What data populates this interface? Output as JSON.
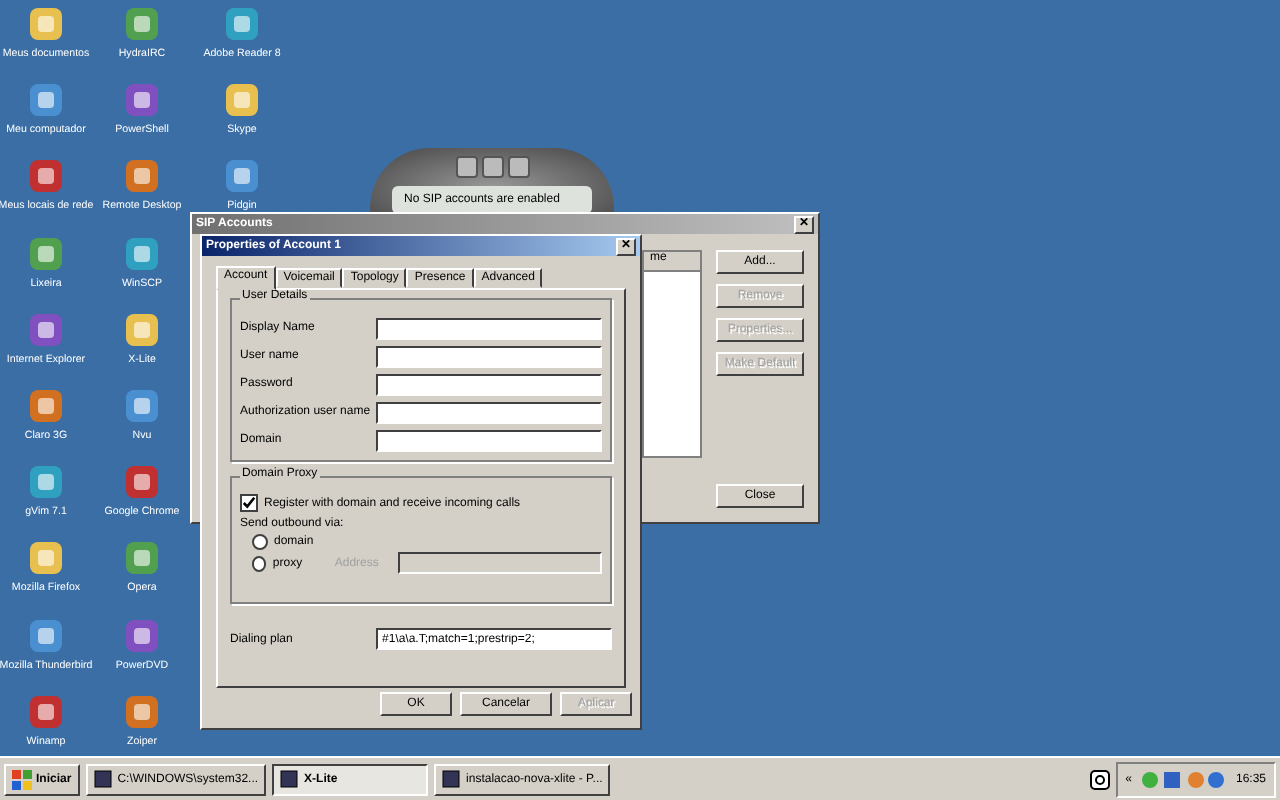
{
  "desktop_icons": [
    [
      {
        "label": "Meus documentos"
      },
      {
        "label": "Meu computador"
      },
      {
        "label": "Meus locais de rede"
      },
      {
        "label": "Lixeira"
      },
      {
        "label": "Internet Explorer"
      },
      {
        "label": "Claro 3G"
      },
      {
        "label": "gVim 7.1"
      },
      {
        "label": "Mozilla Firefox"
      },
      {
        "label": "Mozilla Thunderbird"
      },
      {
        "label": "Winamp"
      }
    ],
    [
      {
        "label": "HydraIRC"
      },
      {
        "label": "PowerShell"
      },
      {
        "label": "Remote Desktop"
      },
      {
        "label": "WinSCP"
      },
      {
        "label": "X-Lite"
      },
      {
        "label": "Nvu"
      },
      {
        "label": "Google Chrome"
      },
      {
        "label": "Opera"
      },
      {
        "label": "PowerDVD"
      },
      {
        "label": "Zoiper"
      }
    ],
    [
      {
        "label": "Adobe Reader 8"
      },
      {
        "label": "Skype"
      },
      {
        "label": "Pidgin"
      }
    ]
  ],
  "phone": {
    "status": "No SIP accounts are enabled"
  },
  "sip_accounts": {
    "title": "SIP Accounts",
    "column_header": "me",
    "buttons": [
      {
        "label": "Add...",
        "disabled": false
      },
      {
        "label": "Remove",
        "disabled": true
      },
      {
        "label": "Properties...",
        "disabled": true
      },
      {
        "label": "Make Default",
        "disabled": true
      }
    ],
    "close_button": "Close",
    "close_icon": "✕"
  },
  "properties": {
    "title": "Properties of Account 1",
    "close_icon": "✕",
    "tabs": [
      {
        "label": "Account",
        "selected": true
      },
      {
        "label": "Voicemail",
        "selected": false
      },
      {
        "label": "Topology",
        "selected": false
      },
      {
        "label": "Presence",
        "selected": false
      },
      {
        "label": "Advanced",
        "selected": false
      }
    ],
    "user_details": {
      "title": "User Details",
      "fields": [
        {
          "label": "Display Name"
        },
        {
          "label": "User name"
        },
        {
          "label": "Password"
        },
        {
          "label": "Authorization user name"
        },
        {
          "label": "Domain"
        }
      ]
    },
    "domain_proxy": {
      "title": "Domain Proxy",
      "register": {
        "label": "Register with domain and receive incoming calls",
        "checked": true
      },
      "send_via": "Send outbound via:",
      "options": [
        {
          "label": "domain",
          "selected": false
        },
        {
          "label": "proxy",
          "selected": false
        }
      ],
      "address": {
        "label": "Address",
        "disabled": true
      }
    },
    "dialing_plan": {
      "label": "Dialing plan",
      "value": "#1\\a\\a.T;match=1;prestrip=2;"
    },
    "buttons": [
      {
        "label": "OK",
        "disabled": false
      },
      {
        "label": "Cancelar",
        "disabled": false
      },
      {
        "label": "Aplicar",
        "disabled": true
      }
    ]
  },
  "taskbar": {
    "start": "Iniciar",
    "tasks": [
      {
        "label": "C:\\WINDOWS\\system32...",
        "selected": false
      },
      {
        "label": "X-Lite",
        "selected": true
      },
      {
        "label": "instalacao-nova-xlite - P...",
        "selected": false
      }
    ],
    "tray_expand": "«",
    "clock": "16:35"
  }
}
